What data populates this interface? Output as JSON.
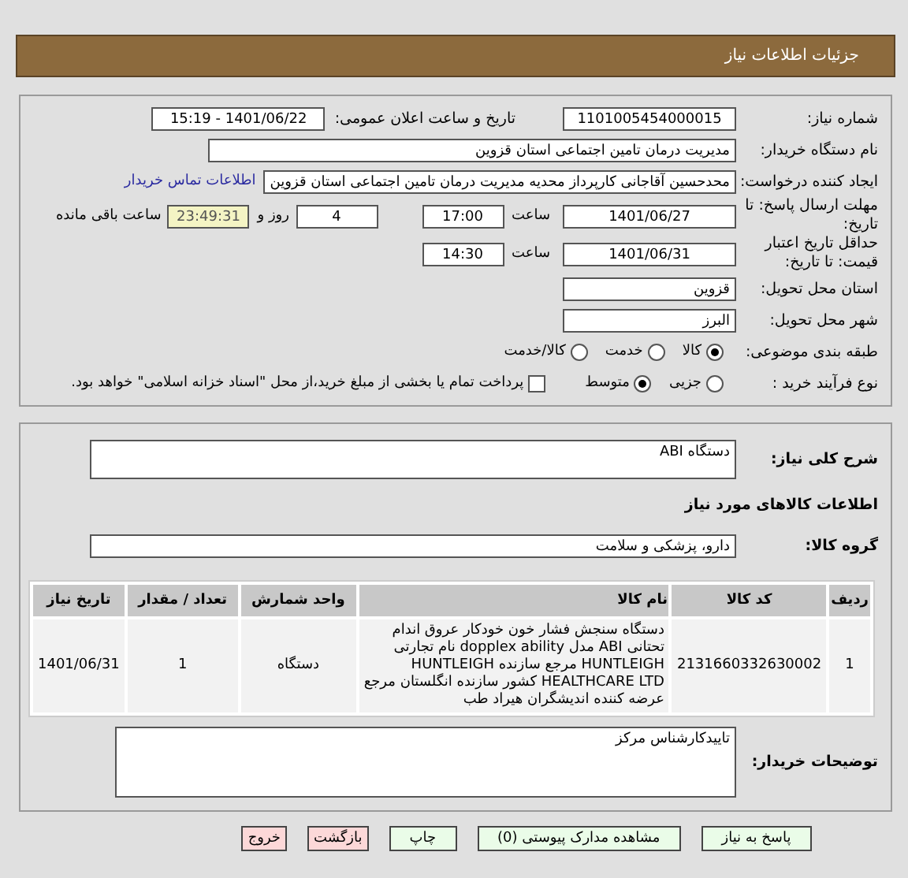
{
  "header": {
    "title": "جزئیات اطلاعات نیاز"
  },
  "details": {
    "need_number": {
      "label": "شماره نیاز:",
      "value": "1101005454000015"
    },
    "announce": {
      "label": "تاریخ و ساعت اعلان عمومی:",
      "value": "1401/06/22 - 15:19"
    },
    "buyer": {
      "label": "نام دستگاه خریدار:",
      "value": "مدیریت درمان تامین اجتماعی استان قزوین"
    },
    "creator": {
      "label": "ایجاد کننده درخواست:",
      "value": "محدحسین آقاجانی کارپرداز محدیه مدیریت درمان تامین اجتماعی استان قزوین",
      "link": "اطلاعات تماس خریدار"
    },
    "deadline": {
      "label": "مهلت ارسال پاسخ: تا تاریخ:",
      "date": "1401/06/27",
      "time_label": "ساعت",
      "time": "17:00",
      "days": "4",
      "days_label": "روز و",
      "remaining": "23:49:31",
      "remaining_label": "ساعت باقی مانده"
    },
    "validity": {
      "label": "حداقل تاریخ اعتبار قیمت: تا تاریخ:",
      "date": "1401/06/31",
      "time_label": "ساعت",
      "time": "14:30"
    },
    "province": {
      "label": "استان محل تحویل:",
      "value": "قزوین"
    },
    "city": {
      "label": "شهر محل تحویل:",
      "value": "البرز"
    },
    "category": {
      "label": "طبقه بندی موضوعی:",
      "options": [
        {
          "label": "کالا",
          "selected": true
        },
        {
          "label": "خدمت",
          "selected": false
        },
        {
          "label": "کالا/خدمت",
          "selected": false
        }
      ]
    },
    "process": {
      "label": "نوع فرآیند خرید :",
      "options": [
        {
          "label": "جزیی",
          "selected": false
        },
        {
          "label": "متوسط",
          "selected": true
        }
      ],
      "payment": {
        "checked": false,
        "label": "پرداخت تمام یا بخشی از مبلغ خرید،از محل \"اسناد خزانه اسلامی\" خواهد بود."
      }
    }
  },
  "summary": {
    "label": "شرح کلی نیاز:",
    "value": "دستگاه ABI"
  },
  "items_title": "اطلاعات کالاهای مورد نیاز",
  "group": {
    "label": "گروه کالا:",
    "value": "دارو، پزشکی و سلامت"
  },
  "items_table": {
    "columns": [
      "ردیف",
      "کد کالا",
      "نام کالا",
      "واحد شمارش",
      "تعداد / مقدار",
      "تاریخ نیاز"
    ],
    "rows": [
      [
        "1",
        "2131660332630002",
        "دستگاه سنجش فشار خون خودکار عروق اندام تحتانی ABI مدل dopplex ability نام تجارتی HUNTLEIGH مرجع سازنده HUNTLEIGH HEALTHCARE LTD کشور سازنده انگلستان مرجع عرضه کننده اندیشگران هیراد طب",
        "دستگاه",
        "1",
        "1401/06/31"
      ]
    ]
  },
  "buyer_notes": {
    "label": "توضیحات خریدار:",
    "value": "تاییدکارشناس مرکز"
  },
  "buttons": [
    {
      "label": "پاسخ به نیاز",
      "kind": "primary"
    },
    {
      "label": "مشاهده مدارک پیوستی (0)",
      "kind": "primary"
    },
    {
      "label": "چاپ",
      "kind": "primary"
    },
    {
      "label": "بازگشت",
      "kind": "danger"
    },
    {
      "label": "خروج",
      "kind": "danger"
    }
  ]
}
